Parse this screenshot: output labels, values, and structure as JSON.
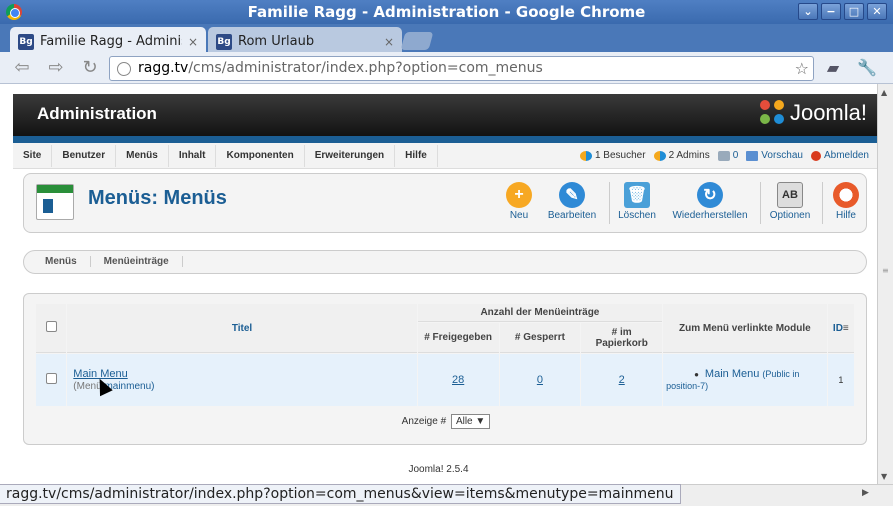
{
  "window": {
    "title": "Familie Ragg - Administration - Google Chrome",
    "controls": [
      "⌄",
      "−",
      "□",
      "✕"
    ]
  },
  "tabs": [
    {
      "favicon": "Bg",
      "label": "Familie Ragg - Administ",
      "close": "×",
      "active": true
    },
    {
      "favicon": "Bg",
      "label": "Rom Urlaub",
      "close": "×",
      "active": false
    }
  ],
  "address": {
    "host": "ragg.tv",
    "path": "/cms/administrator/index.php?option=com_menus"
  },
  "header": {
    "title": "Administration",
    "logo_text": "Joomla!"
  },
  "menu": [
    "Site",
    "Benutzer",
    "Menüs",
    "Inhalt",
    "Komponenten",
    "Erweiterungen",
    "Hilfe"
  ],
  "status": {
    "visitors": "1 Besucher",
    "admins": "2 Admins",
    "messages": "0",
    "preview": "Vorschau",
    "logout": "Abmelden"
  },
  "page_title": "Menüs: Menüs",
  "toolbar": {
    "new": "Neu",
    "edit": "Bearbeiten",
    "delete": "Löschen",
    "rebuild": "Wiederherstellen",
    "options": "Optionen",
    "help": "Hilfe"
  },
  "subnav": [
    "Menüs",
    "Menüeinträge"
  ],
  "table": {
    "headers": {
      "title": "Titel",
      "count_group": "Anzahl der Menüeinträge",
      "published": "# Freigegeben",
      "unpublished": "# Gesperrt",
      "trashed": "# im Papierkorb",
      "modules": "Zum Menü verlinkte Module",
      "id": "ID"
    },
    "rows": [
      {
        "title": "Main Menu",
        "menutype_label": "(Menü",
        "menutype": "mainmenu)",
        "published": "28",
        "unpublished": "0",
        "trashed": "2",
        "module_name": "Main Menu",
        "module_info": "(Public in position-7)",
        "id": "1"
      }
    ]
  },
  "pager": {
    "label": "Anzeige #",
    "selected": "Alle"
  },
  "footer": "Joomla! 2.5.4",
  "status_url": "ragg.tv/cms/administrator/index.php?option=com_menus&view=items&menutype=mainmenu"
}
